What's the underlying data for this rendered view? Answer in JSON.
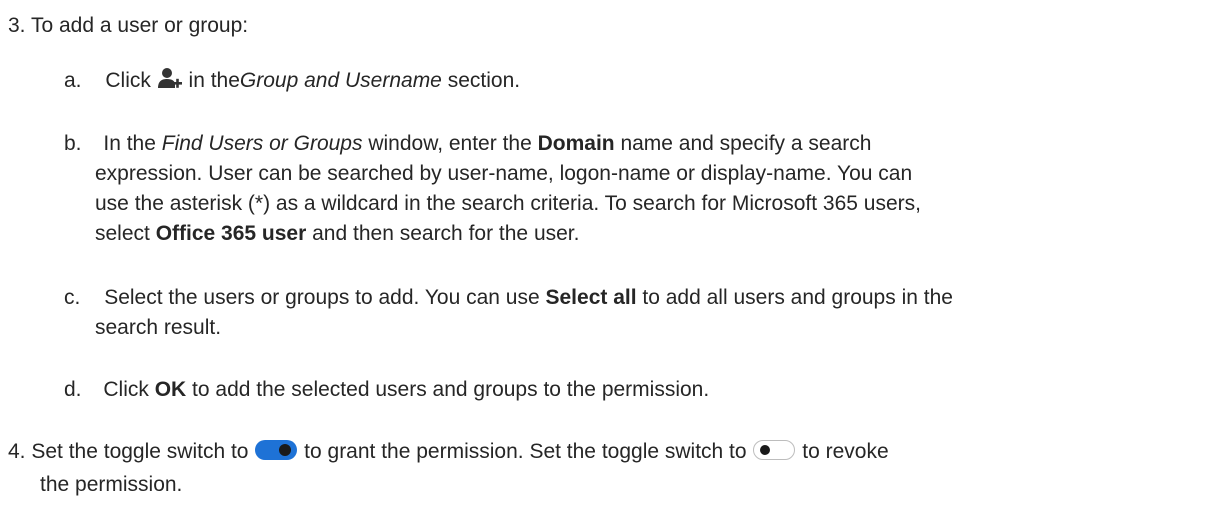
{
  "step3": {
    "number": "3.",
    "text": "To add a user or group:",
    "substeps": {
      "a": {
        "marker": "a.",
        "pre": "Click",
        "mid": "in the",
        "italic": "Group and Username",
        "post": "section.",
        "icon": "add-user-icon"
      },
      "b": {
        "marker": "b.",
        "l1_pre": "In the ",
        "l1_italic": "Find Users or Groups",
        "l1_mid": " window, enter the ",
        "l1_bold": "Domain",
        "l1_post": " name and specify a search",
        "l2": "expression. User can be searched by user-name, logon-name or display-name. You can",
        "l3": "use the asterisk (*) as a wildcard in the search criteria. To search for Microsoft 365 users,",
        "l4_pre": "select ",
        "l4_bold": "Office 365 user",
        "l4_post": " and then search for the user."
      },
      "c": {
        "marker": "c.",
        "l1_pre": "Select the users or groups to add. You can use ",
        "l1_bold": "Select all",
        "l1_post": " to add all users and groups in the",
        "l2": "search result."
      },
      "d": {
        "marker": "d.",
        "pre": "Click ",
        "bold": "OK",
        "post": " to add the selected users and groups to the permission."
      }
    }
  },
  "step4": {
    "number": "4.",
    "l1_pre": "Set the toggle switch to ",
    "l1_mid": " to grant the permission. Set the toggle switch to ",
    "l1_post": " to revoke",
    "l2": "the permission.",
    "toggle_on_icon": "toggle-on-icon",
    "toggle_off_icon": "toggle-off-icon"
  },
  "colors": {
    "text": "#262626",
    "toggle_on": "#1e72d6",
    "toggle_knob": "#1a1a1a",
    "icon": "#333333"
  }
}
